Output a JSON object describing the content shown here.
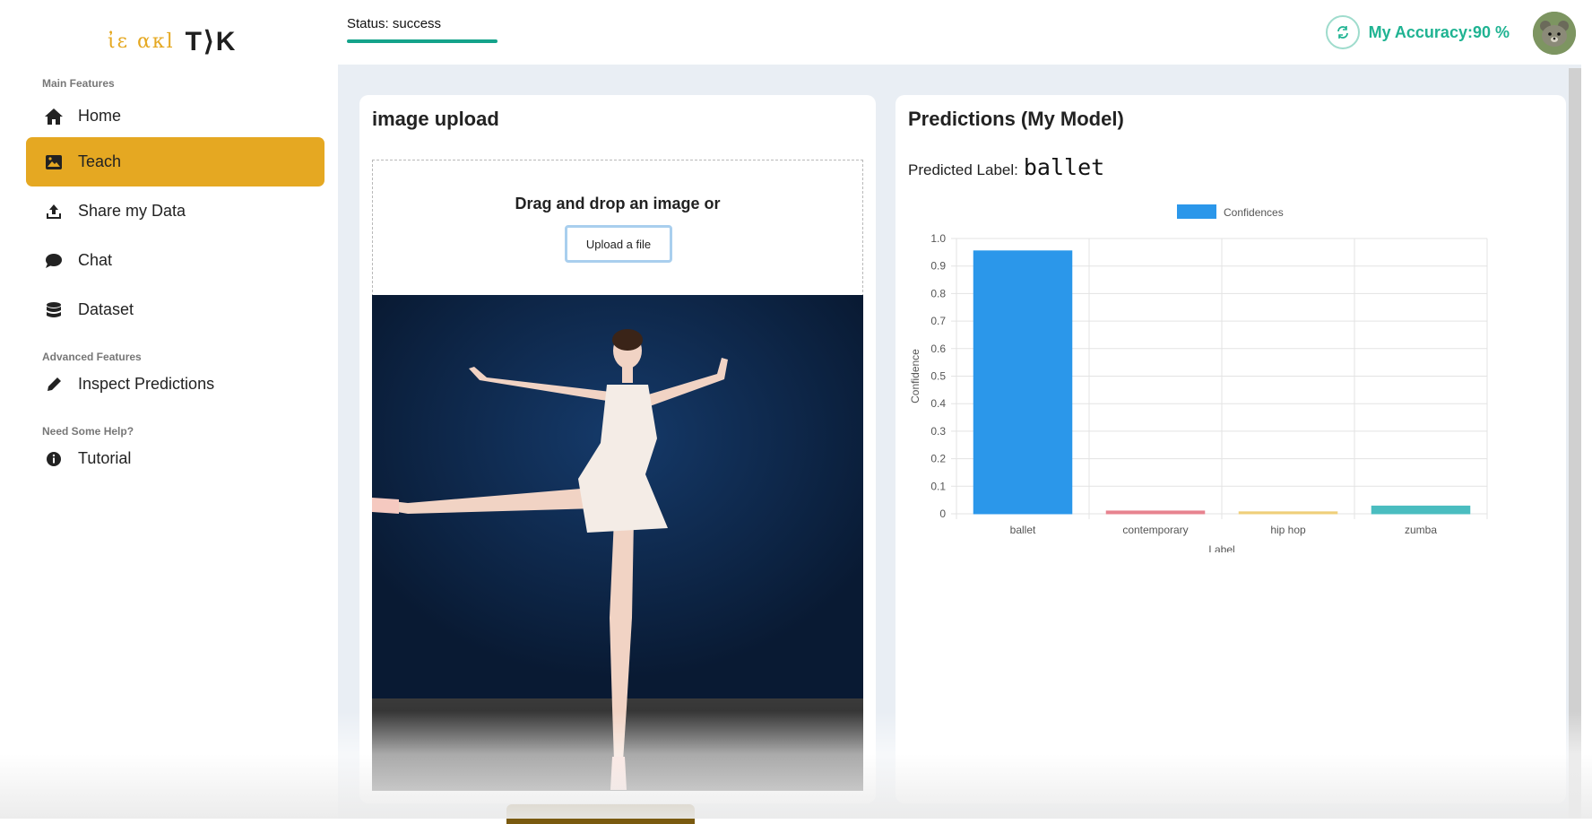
{
  "logo": {
    "part_a": "ἰε ακl",
    "part_b": "T⟩K"
  },
  "sidebar": {
    "sections": [
      {
        "label": "Main Features"
      },
      {
        "label": "Advanced Features"
      },
      {
        "label": "Need Some Help?"
      }
    ],
    "items": [
      {
        "label": "Home",
        "icon": "home-icon",
        "active": false
      },
      {
        "label": "Teach",
        "icon": "image-icon",
        "active": true
      },
      {
        "label": "Share my Data",
        "icon": "upload-icon",
        "active": false
      },
      {
        "label": "Chat",
        "icon": "chat-icon",
        "active": false
      },
      {
        "label": "Dataset",
        "icon": "database-icon",
        "active": false
      },
      {
        "label": "Inspect Predictions",
        "icon": "pencil-icon",
        "active": false
      },
      {
        "label": "Tutorial",
        "icon": "info-icon",
        "active": false
      }
    ]
  },
  "header": {
    "status_text": "Status: success",
    "status_progress": 1.0,
    "accuracy_text": "My Accuracy:90 %",
    "accent_color": "#1fb392"
  },
  "upload_panel": {
    "title": "image upload",
    "drop_text": "Drag and drop an image or",
    "upload_button": "Upload a file"
  },
  "predictions_panel": {
    "title": "Predictions (My Model)",
    "predicted_label_prefix": "Predicted Label:",
    "predicted_label_value": "ballet"
  },
  "chart_data": {
    "type": "bar",
    "categories": [
      "ballet",
      "contemporary",
      "hip hop",
      "zumba"
    ],
    "series": [
      {
        "name": "Confidences",
        "values": [
          0.955,
          0.01,
          0.007,
          0.028
        ]
      }
    ],
    "bar_colors": [
      "#2b97ea",
      "#e7838f",
      "#efcf7a",
      "#4abdc0"
    ],
    "xlabel": "Label",
    "ylabel": "Confidence",
    "ylim": [
      0,
      1.0
    ],
    "yticks": [
      "0",
      "0.1",
      "0.2",
      "0.3",
      "0.4",
      "0.5",
      "0.6",
      "0.7",
      "0.8",
      "0.9",
      "1.0"
    ],
    "legend": "top-center",
    "grid": true
  }
}
